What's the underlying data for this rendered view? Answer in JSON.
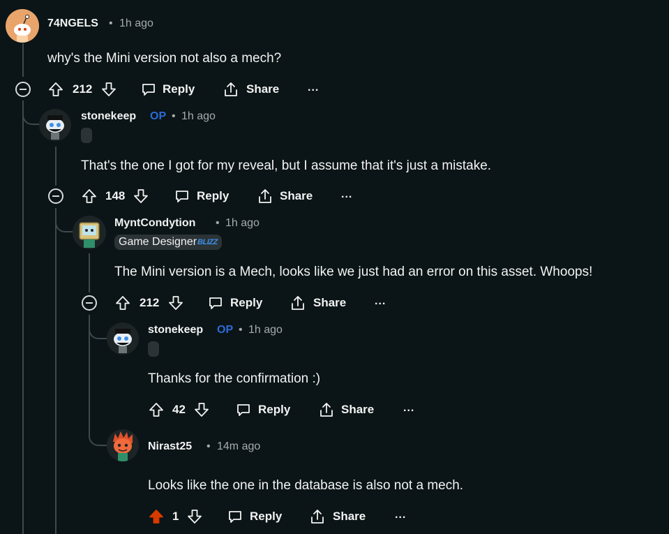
{
  "comments": [
    {
      "username": "74NGELS",
      "time": "1h ago",
      "body": "why's the Mini version not also a mech?",
      "votes": "212",
      "reply": "Reply",
      "share": "Share",
      "more": "..."
    },
    {
      "username": "stonekeep",
      "op": "OP",
      "time": "1h ago",
      "body": "That's the one I got for my reveal, but I assume that it's just a mistake.",
      "votes": "148",
      "reply": "Reply",
      "share": "Share",
      "more": "..."
    },
    {
      "username": "MyntCondytion",
      "time": "1h ago",
      "flair": "Game Designer",
      "flair_tag": "BLIZZ",
      "body": "The Mini version is a Mech, looks like we just had an error on this asset. Whoops!",
      "votes": "212",
      "reply": "Reply",
      "share": "Share",
      "more": "..."
    },
    {
      "username": "stonekeep",
      "op": "OP",
      "time": "1h ago",
      "body": "Thanks for the confirmation :)",
      "votes": "42",
      "reply": "Reply",
      "share": "Share",
      "more": "..."
    },
    {
      "username": "Nirast25",
      "time": "14m ago",
      "body": "Looks like the one in the database is also not a mech.",
      "votes": "1",
      "upvoted": true,
      "reply": "Reply",
      "share": "Share",
      "more": "..."
    }
  ],
  "colors": {
    "background": "#0b1416",
    "op": "#2a6bd8",
    "upvoted": "#d93a00",
    "line": "#3e4a4e"
  }
}
